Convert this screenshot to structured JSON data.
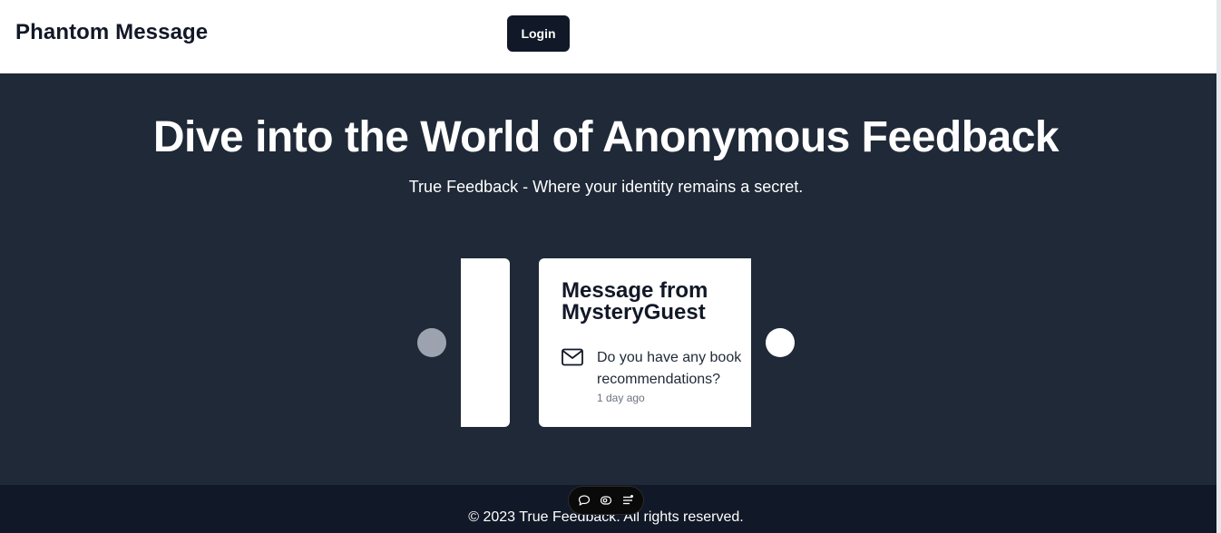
{
  "header": {
    "brand": "Phantom Message",
    "login_label": "Login"
  },
  "hero": {
    "title": "Dive into the World of Anonymous Feedback",
    "subtitle": "True Feedback - Where your identity remains a secret."
  },
  "carousel": {
    "card": {
      "title": "Message from MysteryGuest",
      "icon": "mail-icon",
      "content": "Do you have any book recommendations?",
      "received": "1 day ago"
    },
    "prev_icon": "circle",
    "next_icon": "circle"
  },
  "toolbar": {
    "icons": [
      "chat-bubble-icon",
      "eye-toggle-icon",
      "menu-list-icon"
    ]
  },
  "footer": {
    "text": "© 2023 True Feedback. All rights reserved."
  },
  "colors": {
    "background": "#1f2937",
    "header": "#ffffff",
    "footer": "#111827",
    "button": "#111827",
    "card": "#ffffff",
    "muted": "#6b7280"
  }
}
